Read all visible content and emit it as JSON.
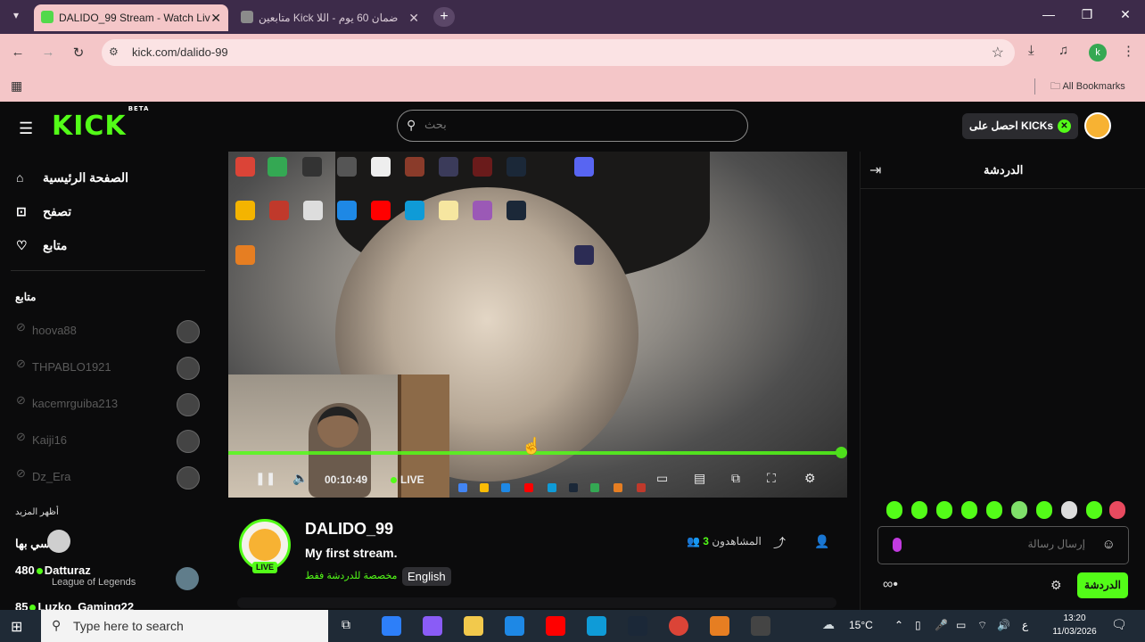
{
  "browser": {
    "tabs": [
      {
        "title": "DALIDO_99 Stream - Watch Liv",
        "active": true
      },
      {
        "title": "متابعين Kick ضمان 60 يوم - اللا",
        "active": false
      }
    ],
    "url": "kick.com/dalido-99",
    "bookmarks_label": "All Bookmarks",
    "profile_initial": "k"
  },
  "header": {
    "logo": "KICK",
    "logo_badge": "BETA",
    "search_placeholder": "بحث",
    "kicks_button": "احصل على KICKs"
  },
  "sidebar": {
    "nav": [
      {
        "label": "الصفحة الرئيسية",
        "icon": "home-icon"
      },
      {
        "label": "تصفح",
        "icon": "browse-icon"
      },
      {
        "label": "متابع",
        "icon": "heart-icon"
      }
    ],
    "following_title": "متابع",
    "following": [
      "hoova88",
      "THPABLO1921",
      "kacemrguiba213",
      "Kaiji16",
      "Dz_Era"
    ],
    "more_title": "أظهر المزيد",
    "recommended": [
      {
        "count": "",
        "name": "سي بها",
        "category": ""
      },
      {
        "count": "480",
        "name": "Datturaz",
        "category": "League of Legends"
      },
      {
        "count": "85",
        "name": "Luzko_Gaming22",
        "category": ""
      }
    ]
  },
  "player": {
    "elapsed": "00:10:49",
    "live_label": "LIVE",
    "progress": 1.0
  },
  "stream": {
    "channel": "DALIDO_99",
    "title": "My first stream.",
    "category": "مخصصة للدردشة فقط",
    "tag": "English",
    "viewers_label": "المشاهدون",
    "viewers_count": "3",
    "live_badge": "LIVE"
  },
  "chat": {
    "title": "الدردشة",
    "placeholder": "إرسال رسالة",
    "send_label": "الدردشة"
  },
  "taskbar": {
    "search_placeholder": "Type here to search",
    "temperature": "15°C",
    "lang": "ع",
    "time": "13:20",
    "date": "11/03/2026"
  },
  "colors": {
    "accent": "#53fc18",
    "chrome": "#f4c6c8",
    "tabbar": "#3d2b4a"
  }
}
